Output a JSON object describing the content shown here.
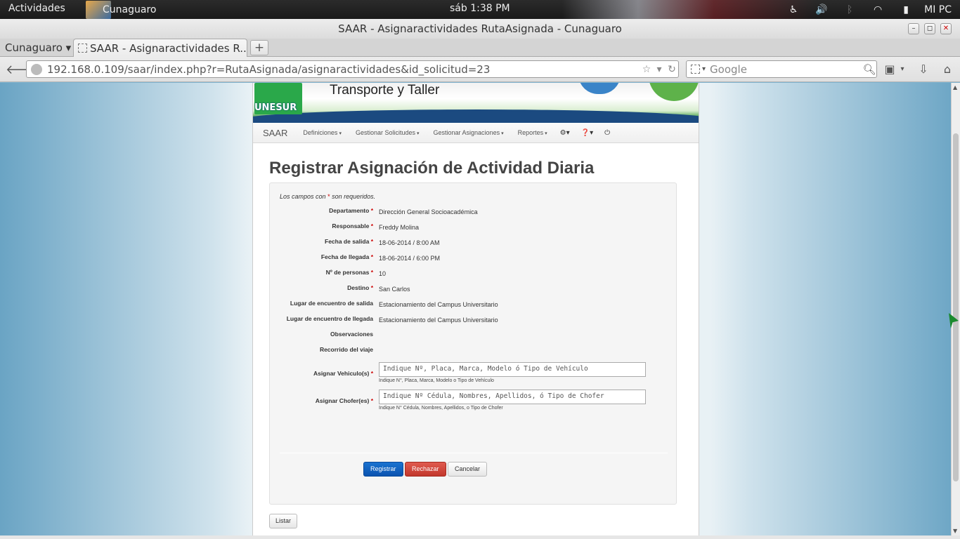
{
  "topbar": {
    "activities": "Actividades",
    "app_name": "Cunaguaro",
    "clock": "sáb  1:38 PM",
    "user": "MI PC",
    "tray_icons": [
      "accessibility-icon",
      "volume-icon",
      "bluetooth-icon",
      "wifi-icon",
      "battery-icon"
    ]
  },
  "window": {
    "title": "SAAR - Asignaractividades RutaAsignada - Cunaguaro",
    "min": "–",
    "max": "◻",
    "close": "✕"
  },
  "tabs": {
    "group_label": "Cunaguaro ▾",
    "active_tab": "SAAR - Asignaractividades R...",
    "new_tab": "+"
  },
  "nav": {
    "url": "192.168.0.109/saar/index.php?r=RutaAsignada/asignaractividades&id_solicitud=23",
    "search_placeholder": "Google"
  },
  "site": {
    "banner_title": "Transporte y Taller",
    "logo_text": "UNESUR",
    "brand": "SAAR",
    "menu": [
      "Definiciones",
      "Gestionar Solicitudes",
      "Gestionar Asignaciones",
      "Reportes"
    ],
    "icon_menu": [
      "⚙",
      "❓",
      "⏻"
    ]
  },
  "form": {
    "title": "Registrar Asignación de Actividad Diaria",
    "note_prefix": "Los campos con",
    "note_star": "*",
    "note_suffix": "son requeridos.",
    "fields": [
      {
        "label": "Departamento",
        "required": true,
        "value": "Dirección General Socioacadémica"
      },
      {
        "label": "Responsable",
        "required": true,
        "value": "Freddy Molina"
      },
      {
        "label": "Fecha de salida",
        "required": true,
        "value": "18-06-2014 / 8:00 AM"
      },
      {
        "label": "Fecha de llegada",
        "required": true,
        "value": "18-06-2014 / 6:00 PM"
      },
      {
        "label": "Nº de personas",
        "required": true,
        "value": "10"
      },
      {
        "label": "Destino",
        "required": true,
        "value": "San Carlos"
      },
      {
        "label": "Lugar de encuentro de salida",
        "required": false,
        "value": "Estacionamiento del Campus Universitario"
      },
      {
        "label": "Lugar de encuentro de llegada",
        "required": false,
        "value": "Estacionamiento del Campus Universitario"
      },
      {
        "label": "Observaciones",
        "required": false,
        "value": ""
      },
      {
        "label": "Recorrido del viaje",
        "required": false,
        "value": ""
      }
    ],
    "vehiculo_label": "Asignar Vehiculo(s)",
    "vehiculo_placeholder": "Indique Nº, Placa, Marca, Modelo ó Tipo de Vehículo",
    "vehiculo_hint": "Indique N°, Placa, Marca, Modelo o Tipo de Vehículo",
    "chofer_label": "Asignar Chofer(es)",
    "chofer_placeholder": "Indique Nº Cédula, Nombres, Apellidos, ó Tipo de Chofer",
    "chofer_hint": "Indique N° Cédula, Nombres, Apellidos, o Tipo de Chofer",
    "btn_registrar": "Registrar",
    "btn_rechazar": "Rechazar",
    "btn_cancelar": "Cancelar",
    "btn_listar": "Listar"
  }
}
